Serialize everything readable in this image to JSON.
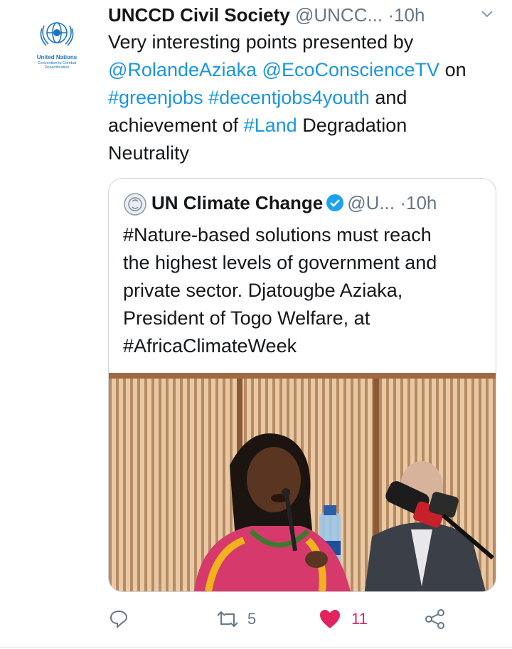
{
  "account": {
    "org_name": "United Nations",
    "org_sub": "Convention to Combat Desertification"
  },
  "tweet": {
    "author_name": "UNCCD Civil Society",
    "handle": "@UNCC...",
    "separator": "·",
    "time": "10h",
    "text_parts": {
      "p1": "Very interesting points presented by",
      "m1": "@RolandeAziaka",
      "m2": "@EcoConscienceTV",
      "p2": " on",
      "h1": "#greenjobs",
      "h2": "#decentjobs4youth",
      "p3": " and",
      "p4": "achievement of ",
      "h3": "#Land",
      "p5": " Degradation",
      "p6": "Neutrality"
    }
  },
  "quoted": {
    "author_name": "UN Climate Change",
    "handle": "@U...",
    "separator": "·",
    "time": "10h",
    "lines": [
      "#Nature-based solutions must reach",
      "the highest levels of government and",
      "private sector. Djatougbe Aziaka,",
      "President of Togo Welfare, at",
      "#AfricaClimateWeek"
    ]
  },
  "actions": {
    "reply_count": "",
    "retweet_count": "5",
    "like_count": "11"
  },
  "colors": {
    "link": "#1b95e0",
    "like": "#e0245e",
    "muted": "#657786",
    "un_blue": "#1b75bb"
  },
  "icons": [
    "un-emblem-icon",
    "chevron-down-icon",
    "un-climate-logo-icon",
    "verified-icon",
    "reply-icon",
    "retweet-icon",
    "heart-icon",
    "share-icon"
  ]
}
